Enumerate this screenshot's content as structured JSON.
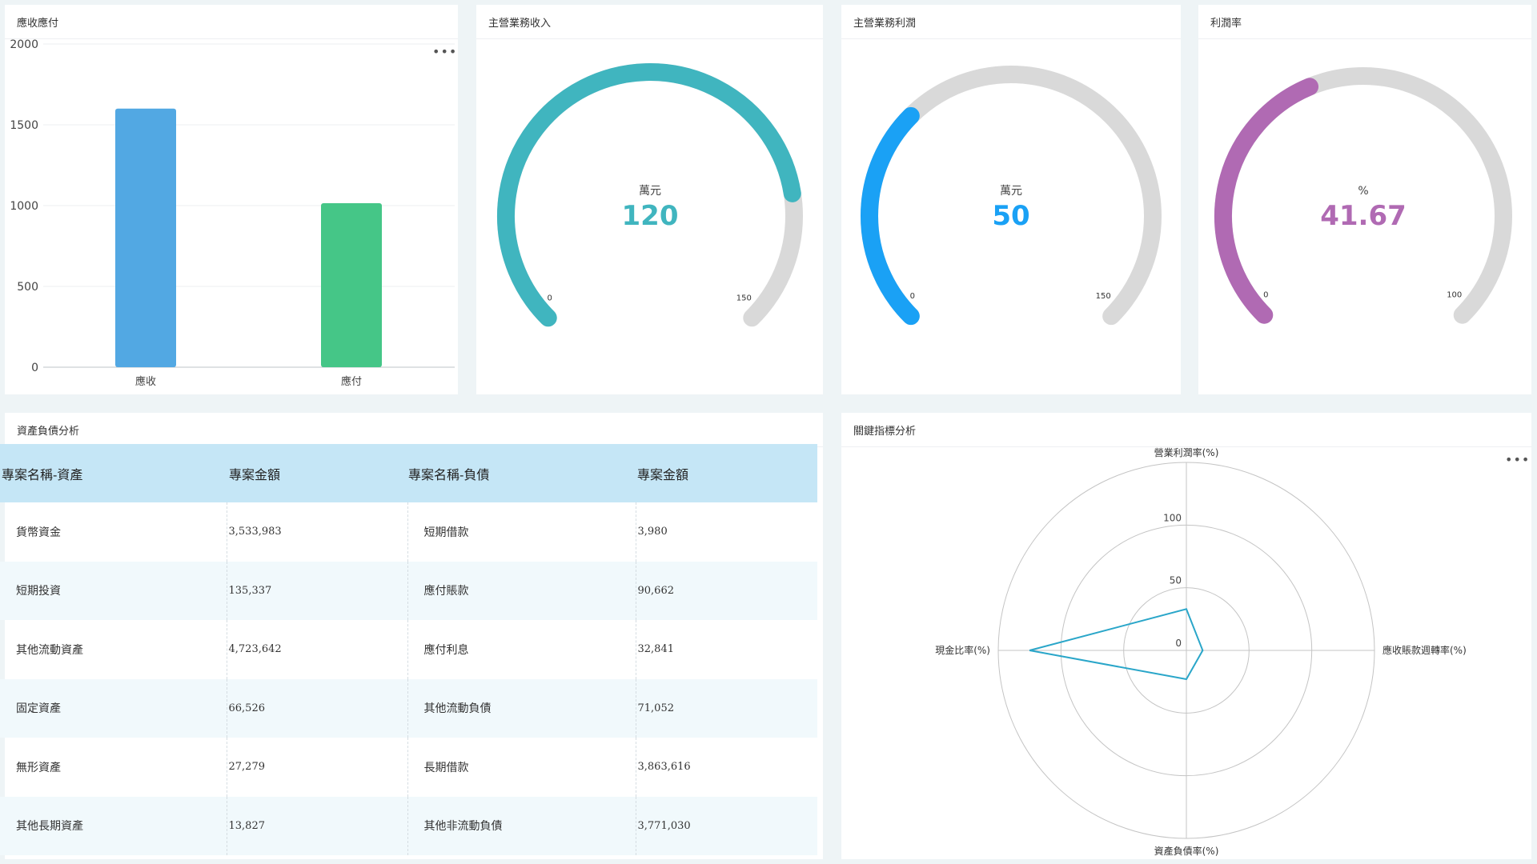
{
  "panels": {
    "ar_ap": "應收應付",
    "revenue": "主營業務收入",
    "profit": "主營業務利潤",
    "margin": "利潤率",
    "balance": "資產負債分析",
    "kpi": "關鍵指標分析"
  },
  "colors": {
    "receivable": "#52a8e3",
    "payable": "#45c687",
    "revenue_gauge": "#40b5bf",
    "profit_gauge": "#1aa1f5",
    "margin_gauge": "#b06ab3",
    "gauge_track": "#d9d9d9",
    "radar_line": "#2aa6c9",
    "table_header": "#c5e6f6"
  },
  "chart_data": [
    {
      "type": "bar",
      "categories": [
        "應收",
        "應付"
      ],
      "values": [
        1600,
        1015
      ],
      "ylim": [
        0,
        2000
      ],
      "yticks": [
        "0",
        "500",
        "1000",
        "1500",
        "2000"
      ],
      "grid": true
    },
    {
      "type": "gauge",
      "value": 120,
      "value_label": "120",
      "unit": "萬元",
      "min": 0,
      "max": 150,
      "min_label": "0",
      "max_label": "150"
    },
    {
      "type": "gauge",
      "value": 50,
      "value_label": "50",
      "unit": "萬元",
      "min": 0,
      "max": 150,
      "min_label": "0",
      "max_label": "150"
    },
    {
      "type": "gauge",
      "value": 41.67,
      "value_label": "41.67",
      "unit": "%",
      "min": 0,
      "max": 100,
      "min_label": "0",
      "max_label": "100"
    },
    {
      "type": "radar",
      "indicators": [
        "營業利潤率(%)",
        "應收賬款週轉率(%)",
        "資產負債率(%)",
        "現金比率(%)"
      ],
      "values": [
        33,
        13,
        23,
        125
      ],
      "max": 150,
      "ring_labels": [
        "0",
        "50",
        "100"
      ]
    }
  ],
  "balance_table": {
    "headers": [
      "專案名稱-資產",
      "專案金額",
      "專案名稱-負債",
      "專案金額"
    ],
    "rows": [
      [
        "貨幣資金",
        "3,533,983",
        "短期借款",
        "3,980"
      ],
      [
        "短期投資",
        "135,337",
        "應付賬款",
        "90,662"
      ],
      [
        "其他流動資產",
        "4,723,642",
        "應付利息",
        "32,841"
      ],
      [
        "固定資產",
        "66,526",
        "其他流動負債",
        "71,052"
      ],
      [
        "無形資產",
        "27,279",
        "長期借款",
        "3,863,616"
      ],
      [
        "其他長期資產",
        "13,827",
        "其他非流動負債",
        "3,771,030"
      ]
    ]
  }
}
